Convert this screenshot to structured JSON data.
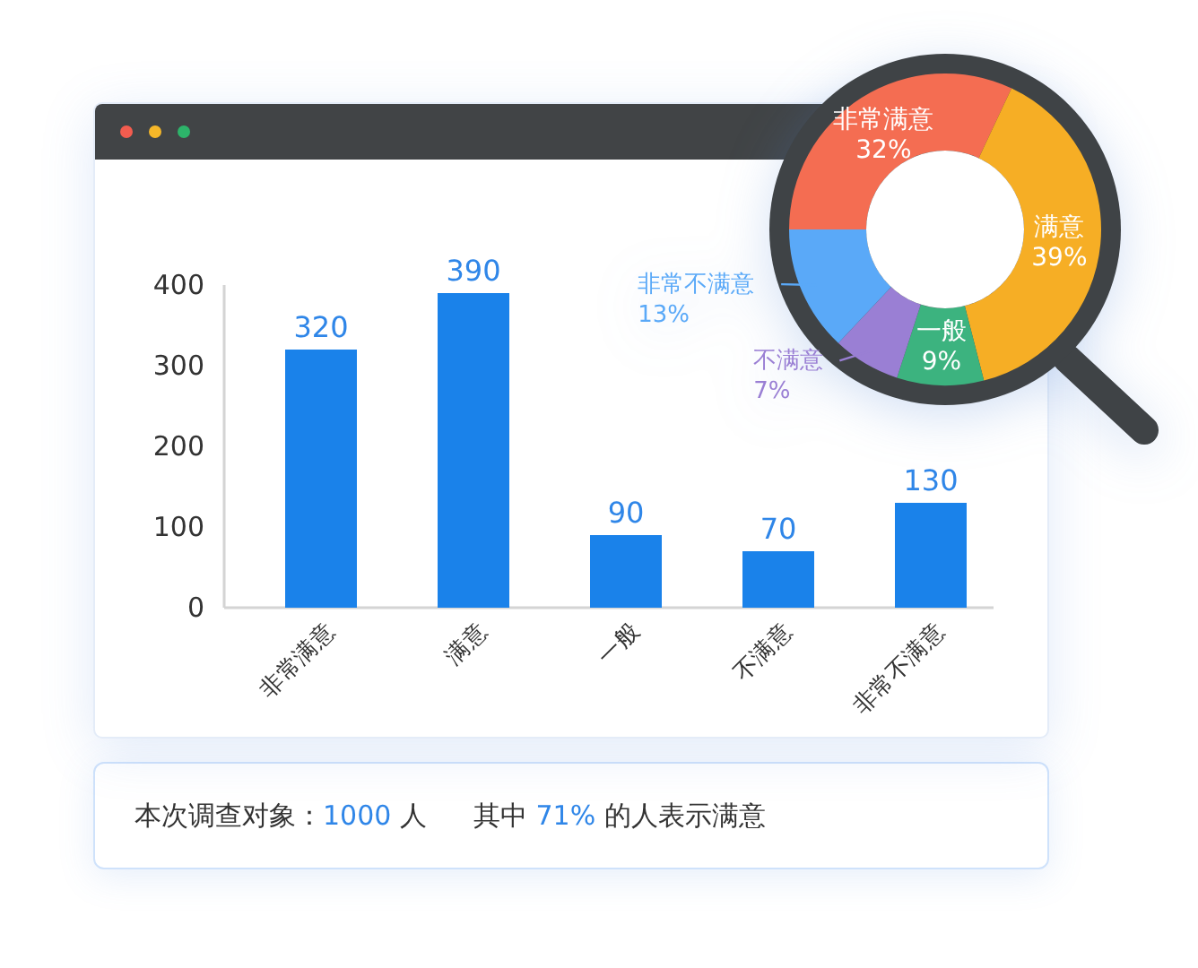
{
  "window": {
    "controls": [
      {
        "color": "#f25c4f"
      },
      {
        "color": "#f5b729"
      },
      {
        "color": "#2db46a"
      }
    ]
  },
  "bar_chart": {
    "chart_data": {
      "type": "bar",
      "categories": [
        "非常满意",
        "满意",
        "一般",
        "不满意",
        "非常不满意"
      ],
      "values": [
        320,
        390,
        90,
        70,
        130
      ],
      "ylim": [
        0,
        400
      ],
      "yticks": [
        0,
        100,
        200,
        300,
        400
      ],
      "data_labels": true
    }
  },
  "magnifier": {
    "chart_data": {
      "type": "donut",
      "categories": [
        "非常满意",
        "满意",
        "一般",
        "不满意",
        "非常不满意"
      ],
      "values": [
        32,
        39,
        9,
        7,
        13
      ],
      "value_labels": [
        "32%",
        "39%",
        "9%",
        "7%",
        "13%"
      ]
    },
    "slices": [
      {
        "kind": "inside",
        "color": "#f46d52"
      },
      {
        "kind": "inside",
        "color": "#f6ae25"
      },
      {
        "kind": "inside",
        "color": "#3cb37f"
      },
      {
        "kind": "outside",
        "color": "#9a7fd4"
      },
      {
        "kind": "outside",
        "color": "#5aa9f8"
      }
    ]
  },
  "summary": [
    {
      "parts": [
        {
          "text": "本次调查对象：",
          "highlight": false
        },
        {
          "text": "1000",
          "highlight": true
        },
        {
          "text": " 人",
          "highlight": false
        }
      ]
    },
    {
      "parts": [
        {
          "text": "其中 ",
          "highlight": false
        },
        {
          "text": "71%",
          "highlight": true
        },
        {
          "text": " 的人表示满意",
          "highlight": false
        }
      ]
    }
  ]
}
